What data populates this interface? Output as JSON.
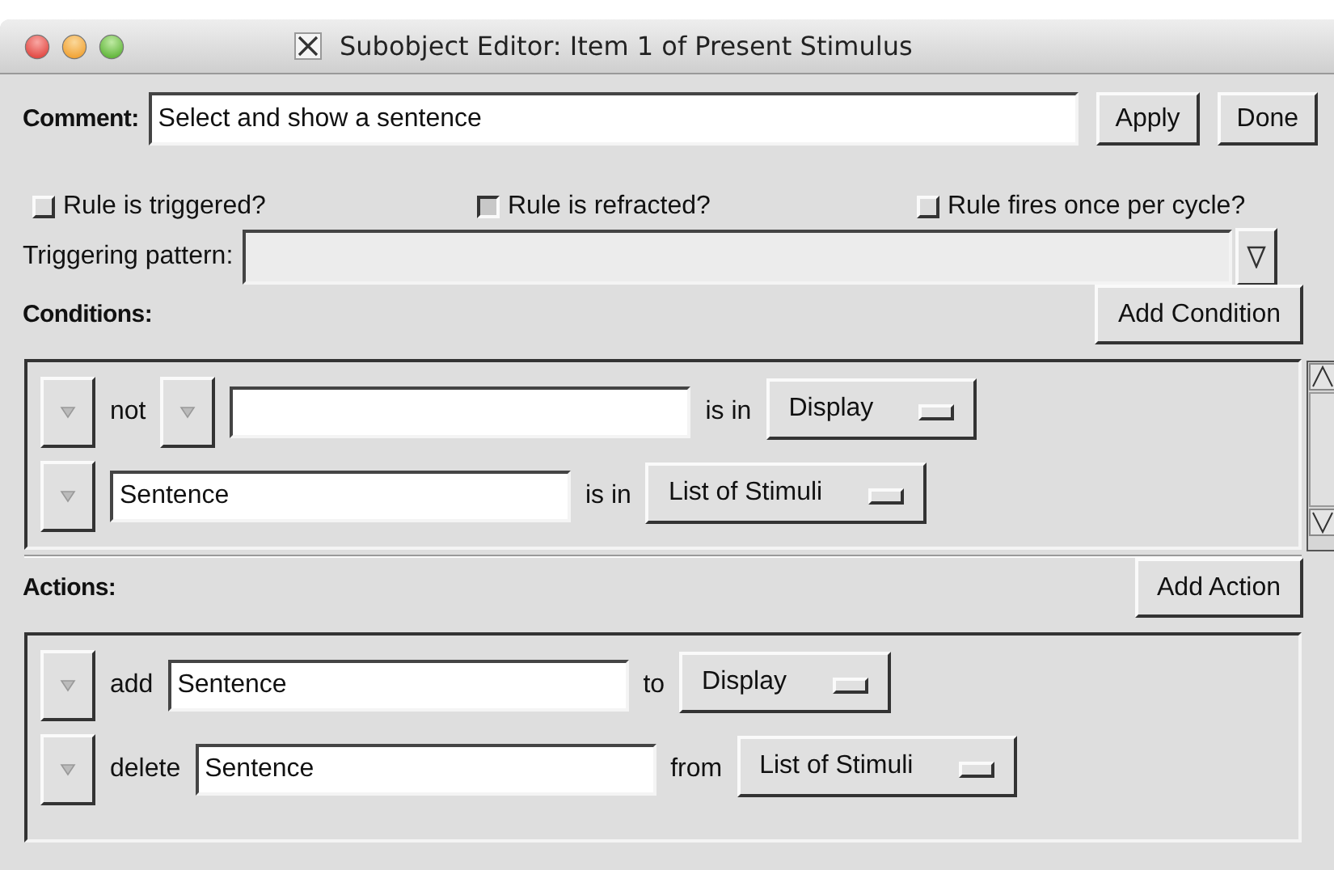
{
  "window": {
    "title": "Subobject Editor: Item 1 of Present Stimulus"
  },
  "comment": {
    "label": "Comment:",
    "value": "Select and show a sentence"
  },
  "buttons": [
    "Apply",
    "Done"
  ],
  "options": [
    {
      "label": "Rule is triggered?",
      "checked": false
    },
    {
      "label": "Rule is refracted?",
      "checked": true
    },
    {
      "label": "Rule fires once per cycle?",
      "checked": false
    }
  ],
  "triggering_pattern": {
    "label": "Triggering pattern:",
    "disabled": true
  },
  "conditions": {
    "label": "Conditions:",
    "add_button": "Add Condition",
    "rows": [
      [
        {
          "kind": "arrow"
        },
        {
          "kind": "word",
          "text": "not"
        },
        {
          "kind": "arrow"
        },
        {
          "kind": "field"
        },
        {
          "kind": "word",
          "text": "is in"
        },
        {
          "kind": "menu",
          "text": "Display"
        }
      ],
      [
        {
          "kind": "arrow"
        },
        {
          "kind": "field",
          "value": "Sentence"
        },
        {
          "kind": "word",
          "text": "is in"
        },
        {
          "kind": "menu",
          "text": "List of Stimuli"
        }
      ]
    ]
  },
  "actions": {
    "label": "Actions:",
    "add_button": "Add Action",
    "rows": [
      [
        {
          "kind": "arrow"
        },
        {
          "kind": "word",
          "text": "add"
        },
        {
          "kind": "field",
          "value": "Sentence"
        },
        {
          "kind": "word",
          "text": "to"
        },
        {
          "kind": "menu",
          "text": "Display"
        }
      ],
      [
        {
          "kind": "arrow"
        },
        {
          "kind": "word",
          "text": "delete"
        },
        {
          "kind": "field",
          "value": "Sentence"
        },
        {
          "kind": "word",
          "text": "from"
        },
        {
          "kind": "menu",
          "text": "List of Stimuli"
        }
      ]
    ]
  }
}
